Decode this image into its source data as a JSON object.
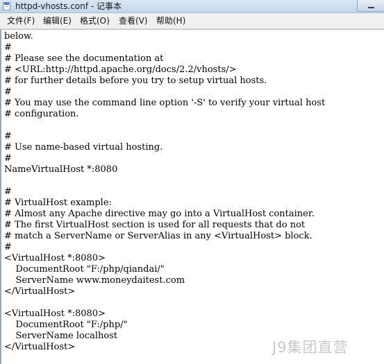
{
  "window": {
    "title": "httpd-vhosts.conf - 记事本"
  },
  "menu": {
    "file": "文件(F)",
    "edit": "编辑(E)",
    "format": "格式(O)",
    "view": "查看(V)",
    "help": "帮助(H)"
  },
  "editor": {
    "lines": [
      "below.",
      "#",
      "# Please see the documentation at",
      "# <URL:http://httpd.apache.org/docs/2.2/vhosts/>",
      "# for further details before you try to setup virtual hosts.",
      "#",
      "# You may use the command line option '-S' to verify your virtual host",
      "# configuration.",
      "",
      "#",
      "# Use name-based virtual hosting.",
      "#",
      "NameVirtualHost *:8080",
      "",
      "#",
      "# VirtualHost example:",
      "# Almost any Apache directive may go into a VirtualHost container.",
      "# The first VirtualHost section is used for all requests that do not",
      "# match a ServerName or ServerAlias in any <VirtualHost> block.",
      "#",
      "<VirtualHost *:8080>",
      "    DocumentRoot \"F:/php/qiandai/\"",
      "    ServerName www.moneydaitest.com",
      "</VirtualHost>",
      "",
      "<VirtualHost *:8080>",
      "    DocumentRoot \"F:/php/\"",
      "    ServerName localhost",
      "</VirtualHost>"
    ]
  },
  "watermark": {
    "text": "J9集团直营"
  },
  "icons": {
    "app": "notepad-icon",
    "minimize": "minimize-icon"
  }
}
